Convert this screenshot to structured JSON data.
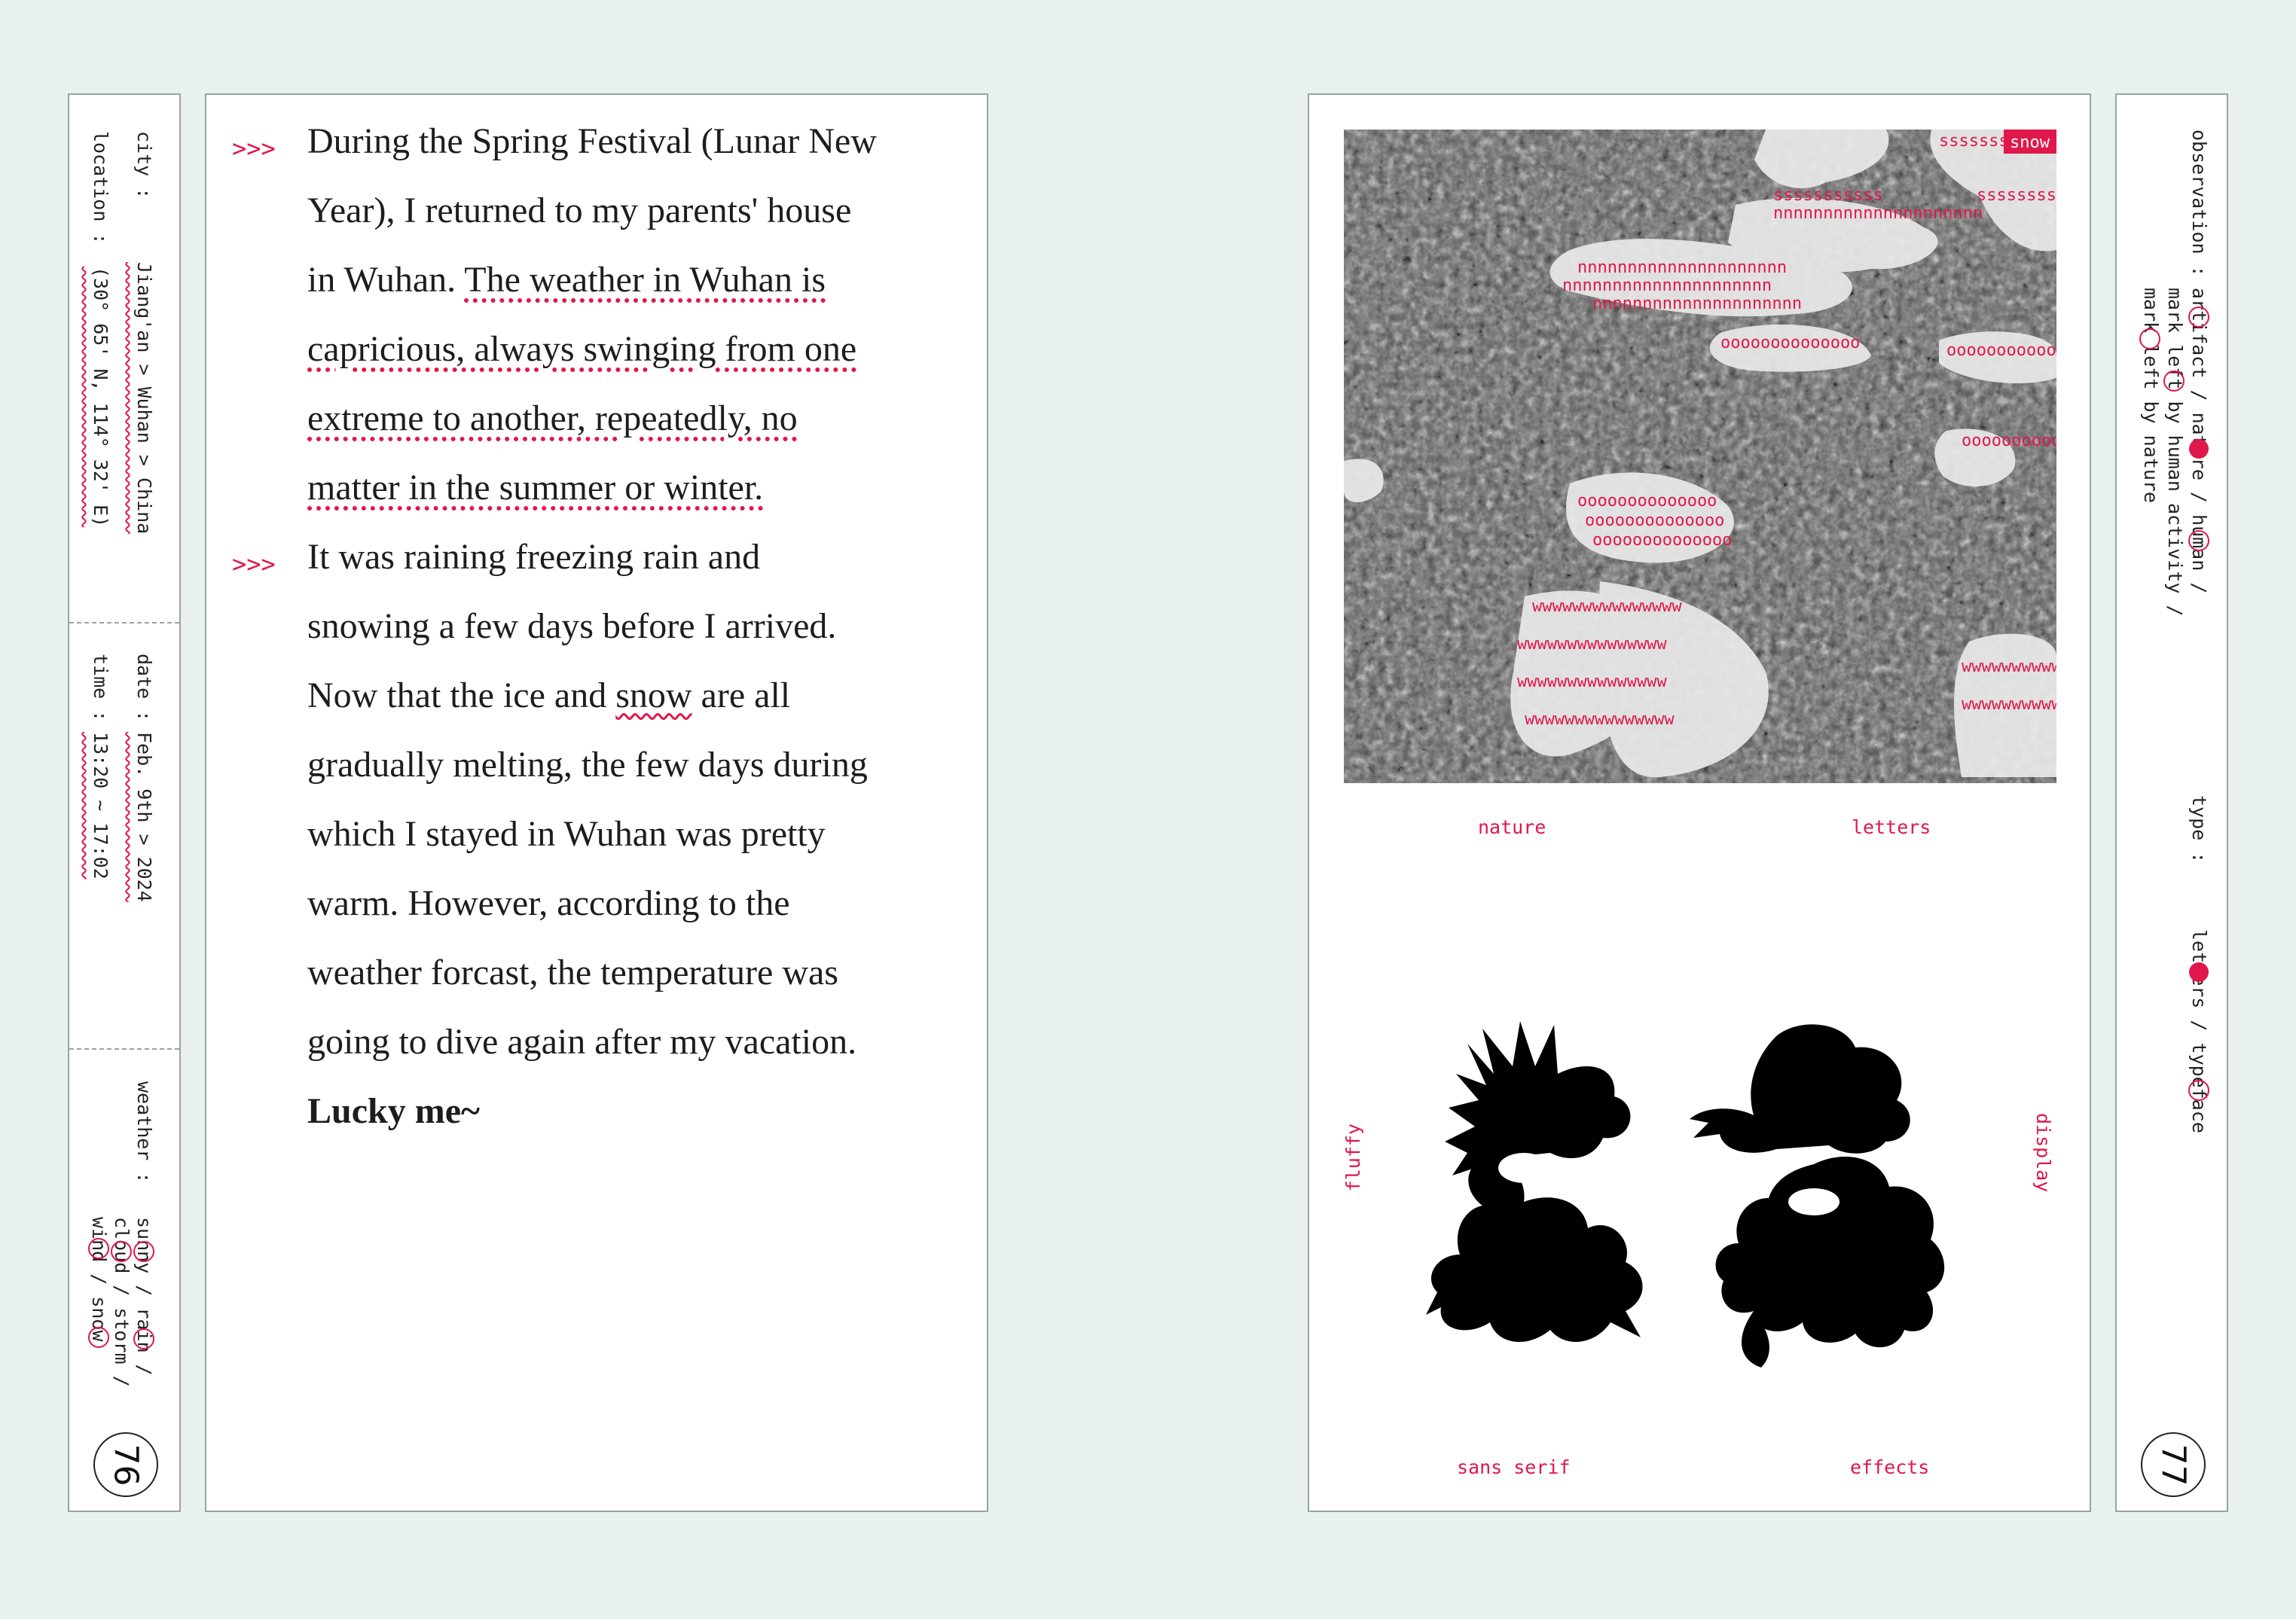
{
  "left_strip": {
    "city_label": "city :",
    "city_value": "Jiang'an > Wuhan > China",
    "location_label": "location :",
    "location_value": "(30° 65' N, 114° 32' E)",
    "date_label": "date :",
    "date_value": "Feb. 9th > 2024",
    "time_label": "time :",
    "time_value": "13:20 ~ 17:02",
    "weather_label": "weather :",
    "weather_line1": "sunny / rain /",
    "weather_line2": "cloud / storm /",
    "weather_line3": "wind / snow",
    "page_number": "76"
  },
  "text_page": {
    "marker": ">>>",
    "p1": {
      "l1": "During the Spring Festival (Lunar New",
      "l2": "Year), I returned to my parents' house",
      "l3a": "in Wuhan. ",
      "l3b": "The weather in Wuhan is",
      "l4": "capricious, always swinging from one",
      "l5": "extreme to another, repeatedly, no",
      "l6": "matter in the summer or winter."
    },
    "p2": {
      "l1": "It was raining freezing rain and",
      "l2": "snowing a few days before I arrived.",
      "l3a": "Now that the ice and ",
      "l3b": "snow",
      "l3c": " are all",
      "l4": "gradually melting, the few days during",
      "l5": "which I stayed in Wuhan was pretty",
      "l6": "warm. However, according to the",
      "l7": "weather forcast,  the temperature was",
      "l8": "going to dive again after my vacation.",
      "l9": "Lucky me~"
    }
  },
  "image_page": {
    "photo_tag": "snow",
    "letter_patterns": {
      "s": "sssssssssss",
      "n": "nnnnnnnnnnnnnnnnnnnnn",
      "o": "oooooooooooooo",
      "w": "wwwwwwwwwwwwwww"
    },
    "caption_nature": "nature",
    "caption_letters": "letters",
    "caption_fluffy": "fluffy",
    "caption_display": "display",
    "caption_sans_serif": "sans serif",
    "caption_effects": "effects"
  },
  "right_strip": {
    "observation_label": "observation :",
    "obs_line1": "artifact / nature / human /",
    "obs_line2": "mark left by human activity /",
    "obs_line3": "mark left by nature",
    "type_label": "type :",
    "type_value": "letters / typeface",
    "page_number": "77"
  },
  "colors": {
    "accent": "#e0174a",
    "background": "#e9f1ee",
    "border": "#9aa3a0"
  }
}
